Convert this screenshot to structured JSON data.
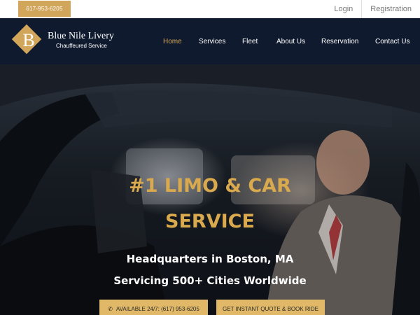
{
  "topbar": {
    "phone": "617-953-6205",
    "login": "Login",
    "registration": "Registration"
  },
  "brand": {
    "letter": "B",
    "name": "Blue Nile Livery",
    "tagline": "Chauffeured Service"
  },
  "nav": {
    "items": [
      {
        "label": "Home",
        "active": true
      },
      {
        "label": "Services"
      },
      {
        "label": "Fleet"
      },
      {
        "label": "About Us"
      },
      {
        "label": "Reservation"
      },
      {
        "label": "Contact Us"
      }
    ]
  },
  "hero": {
    "title_line1": "#1 LIMO & CAR",
    "title_line2": "SERVICE",
    "sub_line1": "Headquarters in Boston, MA",
    "sub_line2": "Servicing 500+ Cities Worldwide",
    "cta_available": "AVAILABLE 24/7: (617) 953-6205",
    "cta_quote": "GET INSTANT QUOTE & BOOK RIDE",
    "phone_icon": "phone-icon"
  },
  "colors": {
    "gold": "#d2a65a",
    "navy": "#0f1a2e",
    "title_gold": "#d9a94e"
  }
}
